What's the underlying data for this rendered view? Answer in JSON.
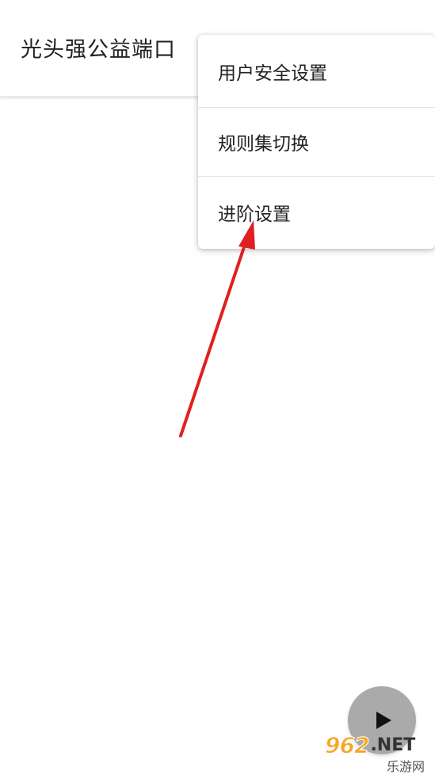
{
  "app_bar": {
    "title": "光头强公益端口"
  },
  "menu": {
    "items": [
      {
        "label": "用户安全设置"
      },
      {
        "label": "规则集切换"
      },
      {
        "label": "进阶设置"
      }
    ]
  },
  "annotation": {
    "arrow_color": "#e02020",
    "points_to": "进阶设置"
  },
  "fab": {
    "icon": "play-icon",
    "background": "#aaaaaa"
  },
  "watermark": {
    "number": "962",
    "suffix": ".NET",
    "subtitle": "乐游网"
  }
}
